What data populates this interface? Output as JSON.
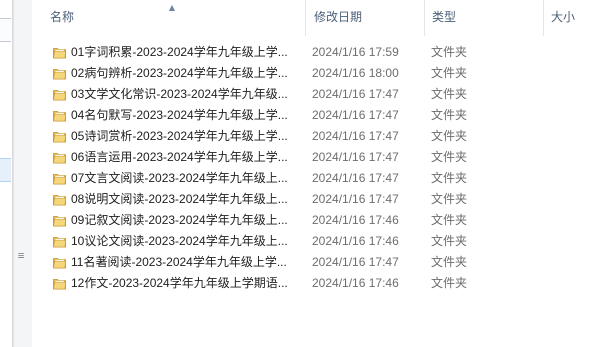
{
  "columns": {
    "name": "名称",
    "date_modified": "修改日期",
    "type": "类型",
    "size": "大小"
  },
  "sort": {
    "column": "name",
    "direction": "ascending",
    "indicator": "▲"
  },
  "splitter": {
    "grip": "≡"
  },
  "files": [
    {
      "name": "01字词积累-2023-2024学年九年级上学...",
      "date": "2024/1/16 17:59",
      "type": "文件夹",
      "icon": "folder-icon"
    },
    {
      "name": "02病句辨析-2023-2024学年九年级上学...",
      "date": "2024/1/16 18:00",
      "type": "文件夹",
      "icon": "folder-icon"
    },
    {
      "name": "03文学文化常识-2023-2024学年九年级...",
      "date": "2024/1/16 17:47",
      "type": "文件夹",
      "icon": "folder-icon"
    },
    {
      "name": "04名句默写-2023-2024学年九年级上学...",
      "date": "2024/1/16 17:47",
      "type": "文件夹",
      "icon": "folder-icon"
    },
    {
      "name": "05诗词赏析-2023-2024学年九年级上学...",
      "date": "2024/1/16 17:47",
      "type": "文件夹",
      "icon": "folder-icon"
    },
    {
      "name": "06语言运用-2023-2024学年九年级上学...",
      "date": "2024/1/16 17:47",
      "type": "文件夹",
      "icon": "folder-icon"
    },
    {
      "name": "07文言文阅读-2023-2024学年九年级上...",
      "date": "2024/1/16 17:47",
      "type": "文件夹",
      "icon": "folder-icon"
    },
    {
      "name": "08说明文阅读-2023-2024学年九年级上...",
      "date": "2024/1/16 17:47",
      "type": "文件夹",
      "icon": "folder-icon"
    },
    {
      "name": "09记叙文阅读-2023-2024学年九年级上...",
      "date": "2024/1/16 17:46",
      "type": "文件夹",
      "icon": "folder-icon"
    },
    {
      "name": "10议论文阅读-2023-2024学年九年级上...",
      "date": "2024/1/16 17:46",
      "type": "文件夹",
      "icon": "folder-icon"
    },
    {
      "name": "11名著阅读-2023-2024学年九年级上学...",
      "date": "2024/1/16 17:47",
      "type": "文件夹",
      "icon": "folder-icon"
    },
    {
      "name": "12作文-2023-2024学年九年级上学期语...",
      "date": "2024/1/16 17:46",
      "type": "文件夹",
      "icon": "folder-icon"
    }
  ],
  "colors": {
    "folder_body": "#e8b84a",
    "folder_front": "#f6d67a",
    "folder_edge": "#c2922b",
    "header_text": "#4c607a",
    "secondary_text": "#6d6d6d"
  }
}
